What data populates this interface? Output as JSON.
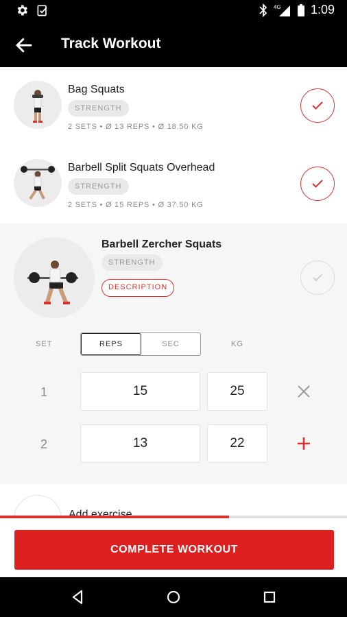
{
  "status_bar": {
    "time": "1:09",
    "network": "4G"
  },
  "app_bar": {
    "title": "Track Workout",
    "back_icon": "arrow-left-icon"
  },
  "exercises": [
    {
      "name": "Bag Squats",
      "tag": "STRENGTH",
      "meta": "2 SETS • Ø 13 REPS • Ø 18.50 KG",
      "completed": true
    },
    {
      "name": "Barbell Split Squats Overhead",
      "tag": "STRENGTH",
      "meta": "2 SETS • Ø 15 REPS • Ø 37.50 KG",
      "completed": true
    }
  ],
  "current_exercise": {
    "name": "Barbell Zercher Squats",
    "tag": "STRENGTH",
    "description_label": "DESCRIPTION",
    "completed": false,
    "columns": {
      "set": "SET",
      "reps": "REPS",
      "sec": "SEC",
      "kg": "KG"
    },
    "active_mode": "REPS",
    "sets": [
      {
        "set": "1",
        "reps": "15",
        "kg": "25",
        "action": "remove"
      },
      {
        "set": "2",
        "reps": "13",
        "kg": "22",
        "action": "add"
      }
    ]
  },
  "next_item": {
    "label": "Add exercise"
  },
  "progress": {
    "fraction": 0.66
  },
  "complete_button": {
    "label": "COMPLETE WORKOUT"
  },
  "colors": {
    "accent": "#d9322d",
    "button": "#dc1f1f",
    "bar": "#000000"
  }
}
